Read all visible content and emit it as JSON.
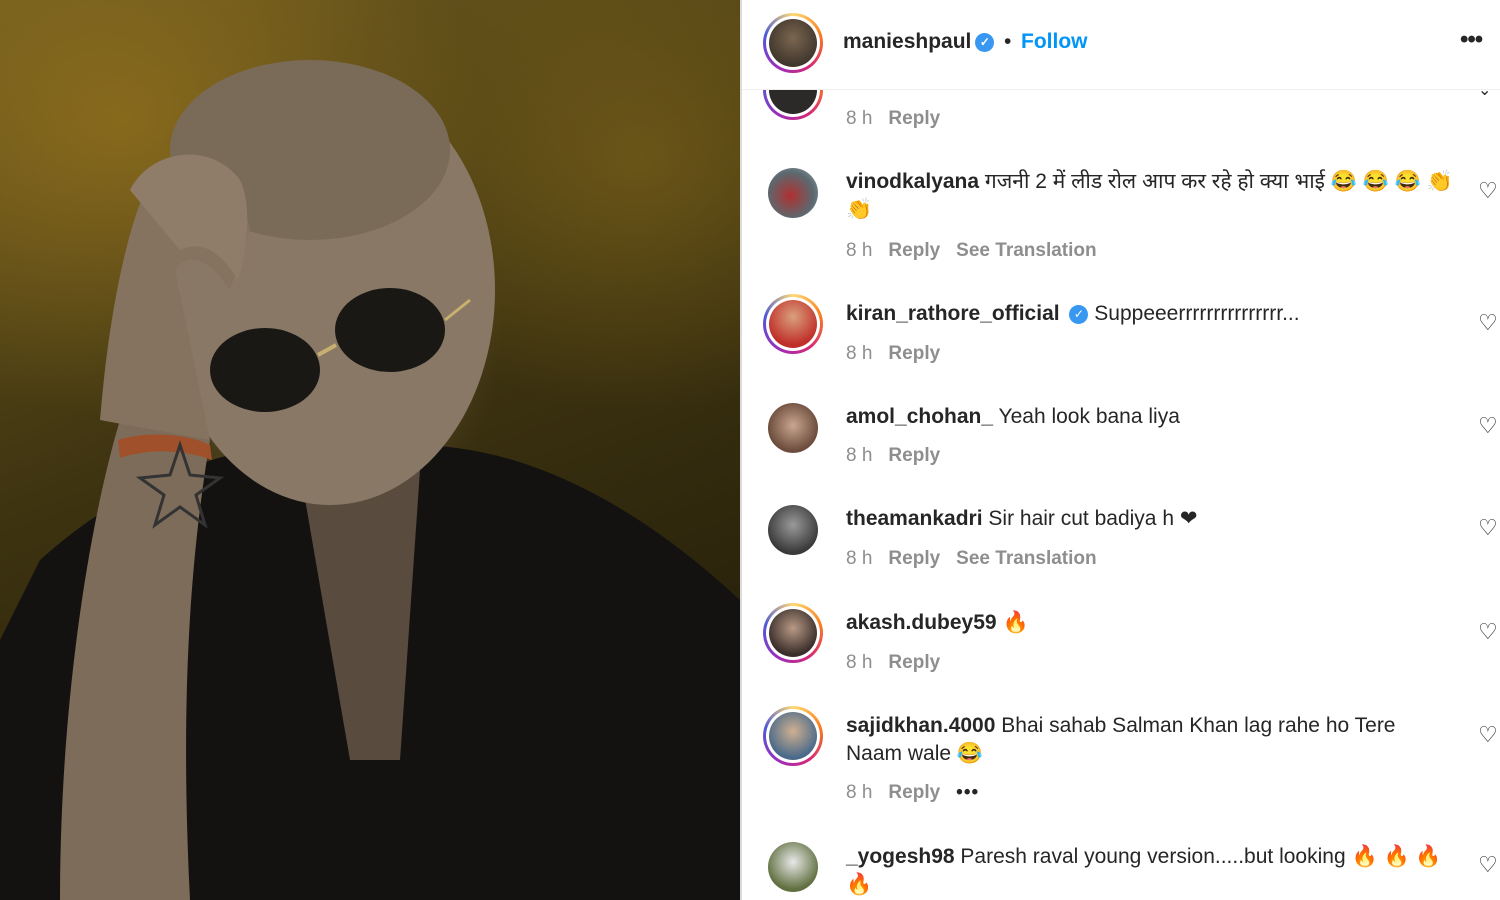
{
  "header": {
    "username": "manieshpaul",
    "verified_glyph": "✓",
    "separator": "•",
    "follow_label": "Follow",
    "more_label": "•••"
  },
  "colors": {
    "accent": "#0095f6",
    "verified": "#3897f0",
    "muted": "#8e8e8e"
  },
  "comments": [
    {
      "user": "",
      "text": "",
      "time": "8 h",
      "reply": "Reply"
    },
    {
      "user": "vinodkalyana",
      "text": "गजनी 2 में लीड रोल आप कर रहे हो क्या भाई 😂 😂 😂 👏 👏",
      "time": "8 h",
      "reply": "Reply",
      "translation": "See Translation"
    },
    {
      "user": "kiran_rathore_official",
      "verified": "✓",
      "text": "Suppeeerrrrrrrrrrrrrrr...",
      "time": "8 h",
      "reply": "Reply"
    },
    {
      "user": "amol_chohan_",
      "text": "Yeah look bana liya",
      "time": "8 h",
      "reply": "Reply"
    },
    {
      "user": "theamankadri",
      "text": "Sir hair cut badiya h ❤",
      "time": "8 h",
      "reply": "Reply",
      "translation": "See Translation"
    },
    {
      "user": "akash.dubey59",
      "text": "🔥",
      "time": "8 h",
      "reply": "Reply"
    },
    {
      "user": "sajidkhan.4000",
      "text": "Bhai sahab Salman Khan lag rahe ho Tere Naam wale 😂",
      "time": "8 h",
      "reply": "Reply",
      "more": "•••"
    },
    {
      "user": "_yogesh98",
      "text": "Paresh raval young version.....but looking 🔥 🔥 🔥 🔥",
      "time": "",
      "reply": ""
    }
  ],
  "heart_glyph": "♡"
}
